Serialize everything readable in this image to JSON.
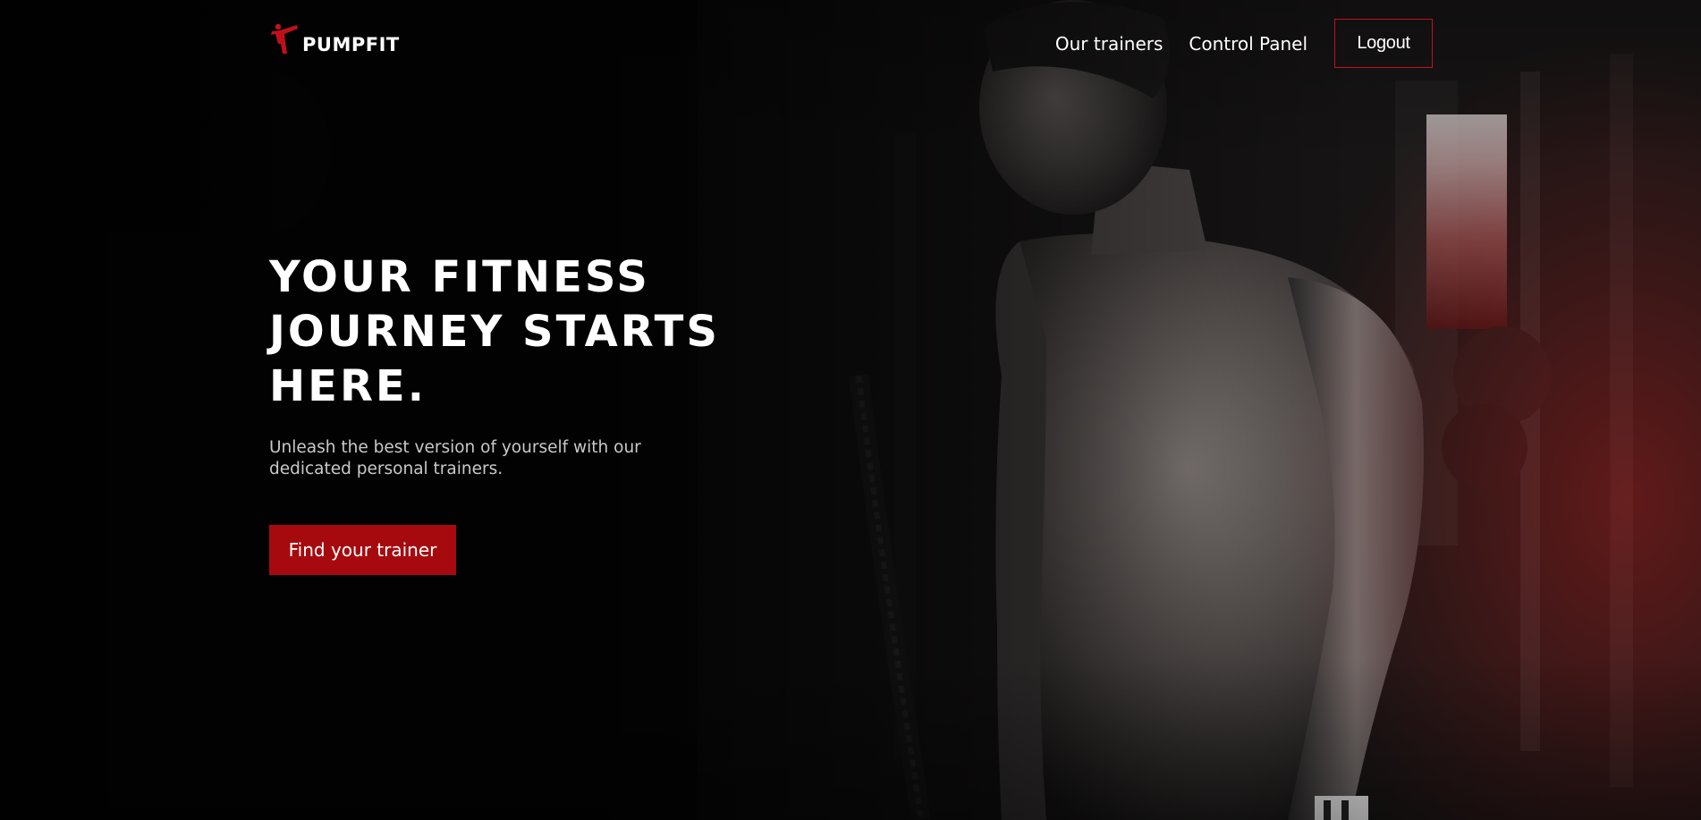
{
  "brand": {
    "name": "PUMPFIT",
    "logo_icon": "figure-kick-icon",
    "accent_color": "#c0111b"
  },
  "nav": {
    "links": [
      {
        "label": "Our trainers"
      },
      {
        "label": "Control Panel"
      }
    ],
    "logout_label": "Logout"
  },
  "hero": {
    "title_lines": [
      "YOUR FITNESS",
      "JOURNEY STARTS",
      "HERE."
    ],
    "subtitle_lines": [
      "Unleash the best version of yourself with our",
      "dedicated personal trainers."
    ],
    "cta_label": "Find your trainer",
    "cta_color": "#a60a0f",
    "background_image": "gym-athlete-photo"
  }
}
